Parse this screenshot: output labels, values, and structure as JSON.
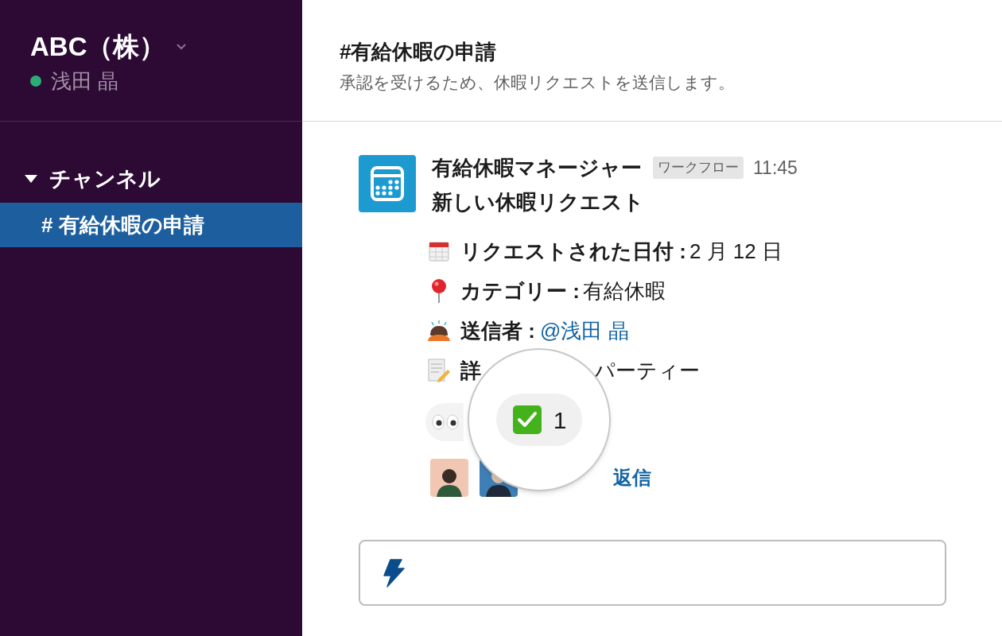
{
  "sidebar": {
    "workspace": "ABC（株）",
    "user": {
      "name": "浅田 晶",
      "online": true
    },
    "sections": [
      {
        "label": "チャンネル",
        "expanded": true,
        "items": [
          {
            "label": "# 有給休暇の申請",
            "selected": true
          }
        ]
      }
    ]
  },
  "channel": {
    "title": "#有給休暇の申請",
    "description": "承認を受けるため、休暇リクエストを送信します。"
  },
  "message": {
    "sender": "有給休暇マネージャー",
    "badge": "ワークフロー",
    "time": "11:45",
    "title": "新しい休暇リクエスト",
    "fields": [
      {
        "kind": "date",
        "label": "リクエストされた日付 :",
        "value": "2 月 12 日"
      },
      {
        "kind": "category",
        "label": "カテゴリー :",
        "value": "有給休暇"
      },
      {
        "kind": "sender",
        "label": "送信者 :",
        "mention": "@浅田 晶"
      },
      {
        "kind": "details",
        "label": "詳",
        "value": "パーティー"
      }
    ],
    "reactions": [
      {
        "kind": "eyes"
      }
    ],
    "replies": {
      "link": "返信"
    }
  },
  "magnifier": {
    "reaction": {
      "kind": "check",
      "count": "1"
    }
  }
}
